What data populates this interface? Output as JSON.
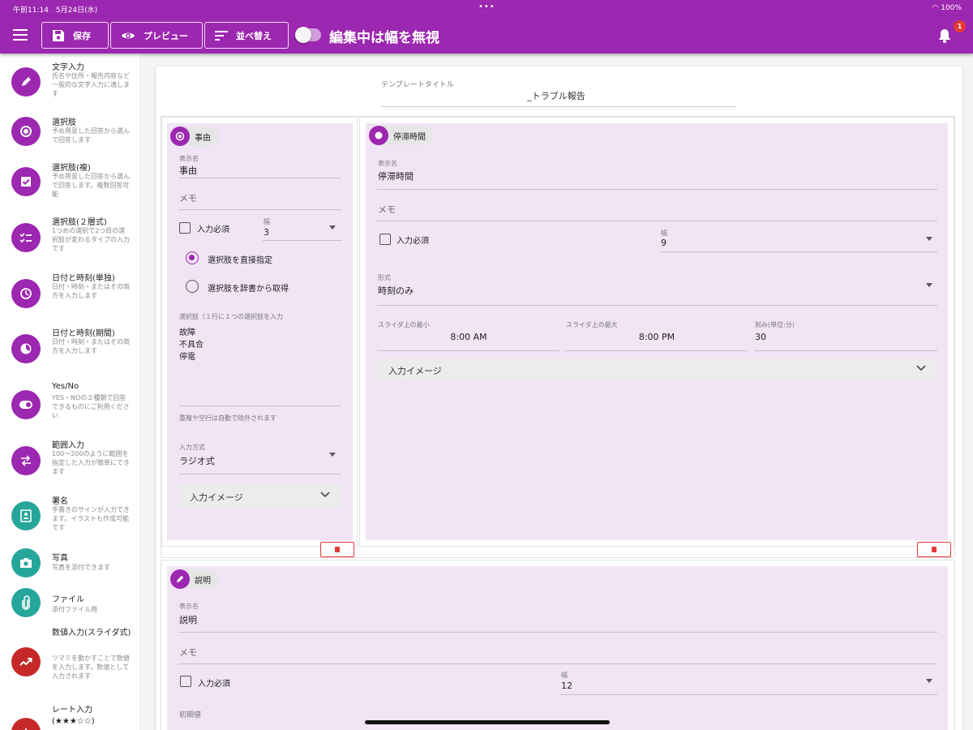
{
  "status_bar": {
    "time": "午前11:14　5月24日(水)",
    "dots": "•••",
    "battery": "100%"
  },
  "toolbar": {
    "save_label": "保存",
    "preview_label": "プレビュー",
    "sort_label": "並べ替え",
    "toggle_label": "編集中は幅を無視",
    "notification_count": "1"
  },
  "colors": {
    "primary": "#9c27b0",
    "teal": "#26a69a",
    "red": "#c62828",
    "field_bg": "#f1e4f5",
    "delete": "#e53935"
  },
  "sidebar": {
    "items": [
      {
        "title": "文字入力",
        "desc": "氏名や住所・報告内容など一般的な文字入力に適します",
        "icon": "pencil-icon",
        "color": "#9c27b0"
      },
      {
        "title": "選択肢",
        "desc": "予め用意した回答から選んで回答します",
        "icon": "radio-icon",
        "color": "#9c27b0"
      },
      {
        "title": "選択肢(複)",
        "desc": "予め用意した回答から選んで回答します。複数回答可能",
        "icon": "checkbox-icon",
        "color": "#9c27b0"
      },
      {
        "title": "選択肢(２層式)",
        "desc": "1つめの選択で2つ目の選択肢が変わるタイプの入力です",
        "icon": "checklist-icon",
        "color": "#9c27b0"
      },
      {
        "title": "日付と時刻(単独)",
        "desc": "日付・時刻・またはその両方を入力します",
        "icon": "clock-icon",
        "color": "#9c27b0"
      },
      {
        "title": "日付と時刻(期間)",
        "desc": "日付・時刻・またはその両方を入力します",
        "icon": "clock-range-icon",
        "color": "#9c27b0"
      },
      {
        "title": "Yes/No",
        "desc": "YES・NOの２種類で回答できるものにご利用ください",
        "icon": "toggle-icon",
        "color": "#9c27b0"
      },
      {
        "title": "範囲入力",
        "desc": "100～200のように範囲を指定した入力が簡単にできます",
        "icon": "swap-icon",
        "color": "#9c27b0"
      },
      {
        "title": "署名",
        "desc": "手書きのサインが入力できます。イラストも作成可能です",
        "icon": "signature-icon",
        "color": "#26a69a"
      },
      {
        "title": "写真",
        "desc": "写真を添付できます",
        "icon": "camera-icon",
        "color": "#26a69a"
      },
      {
        "title": "ファイル",
        "desc": "添付ファイル用",
        "icon": "paperclip-icon",
        "color": "#26a69a"
      },
      {
        "title": "数値入力(スライダ式)",
        "desc": "ツマミを動かすことで数値を入力します。数値として入力されます",
        "icon": "trend-icon",
        "color": "#c62828"
      },
      {
        "title": "レート入力(★★★☆☆)",
        "desc": "",
        "icon": "star-icon",
        "color": "#c62828"
      }
    ]
  },
  "template": {
    "title_label": "テンプレートタイトル",
    "title_value": "_トラブル報告"
  },
  "field_jiyuu": {
    "chip": "事由",
    "display_label": "表示名",
    "display_value": "事由",
    "memo_label": "メモ",
    "required_label": "入力必須",
    "width_label": "幅",
    "width_value": "3",
    "radio_direct": "選択肢を直接指定",
    "radio_dict": "選択肢を辞書から取得",
    "choices_label": "選択肢（１行に１つの選択肢を入力",
    "choices": [
      "故障",
      "不具合",
      "停電"
    ],
    "note": "重複や空行は自動で除外されます",
    "method_label": "入力方式",
    "method_value": "ラジオ式",
    "image_label": "入力イメージ"
  },
  "field_teishi": {
    "chip": "停滞時間",
    "display_label": "表示名",
    "display_value": "停滞時間",
    "memo_label": "メモ",
    "required_label": "入力必須",
    "width_label": "幅",
    "width_value": "9",
    "format_label": "形式",
    "format_value": "時刻のみ",
    "slider_min_label": "スライダ上の最小",
    "slider_min_value": "8:00 AM",
    "slider_max_label": "スライダ上の最大",
    "slider_max_value": "8:00 PM",
    "step_label": "刻み(単位:分)",
    "step_value": "30",
    "image_label": "入力イメージ"
  },
  "field_setsumei": {
    "chip": "説明",
    "display_label": "表示名",
    "display_value": "説明",
    "memo_label": "メモ",
    "required_label": "入力必須",
    "width_label": "幅",
    "width_value": "12",
    "default_label": "初期値"
  }
}
